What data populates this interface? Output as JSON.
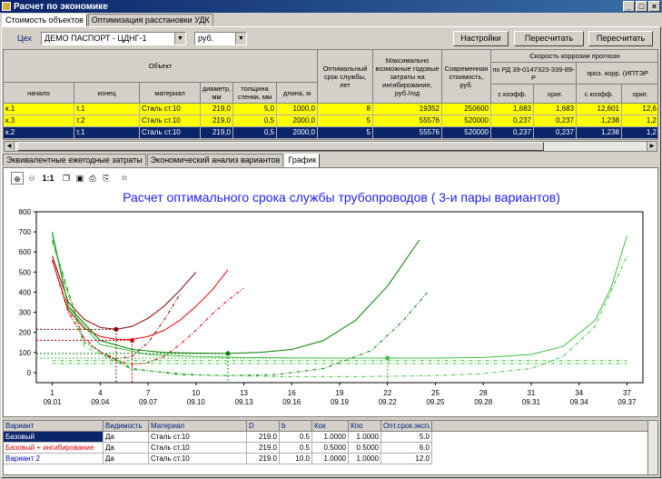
{
  "window": {
    "title": "Расчет по экономике",
    "min": "_",
    "max": "□",
    "close": "×"
  },
  "main_tabs": [
    "Стоимость объектов",
    "Оптимизация расстановки УДК"
  ],
  "toolbar": {
    "shop_label": "Цех",
    "shop_value": "ДЕМО ПАСПОРТ - ЦДНГ-1",
    "currency_value": "руб.",
    "settings": "Настройки",
    "recalc_one": "Пересчитать один",
    "recalc_all": "Пересчитать все"
  },
  "table": {
    "group_object": "Объект",
    "h_start": "начало",
    "h_end": "конец",
    "h_material": "материал",
    "h_diam": "диаметр, мм",
    "h_thick": "толщина стенки, мм",
    "h_len": "длина, м",
    "h_opt": "Оптимальный срок службы, лет",
    "h_max": "Максимально возможные годовые затраты на ингибирование, руб./год",
    "h_cost": "Современная стоимость, руб.",
    "group_corr": "Скорость коррозии прогнозн",
    "h_rd": "по РД 39-0147323-339-89-Р",
    "h_eroz": "эроз. корр. (ИПТЭР",
    "h_kcoef": "с коэфф.",
    "h_orig": "ориг.",
    "h_kcoef2": "с коэфф.",
    "h_orig2": "ориг.",
    "rows": [
      {
        "start": "к.1",
        "end": "т.1",
        "mat": "Сталь ст.10",
        "d": "219,0",
        "t": "5,0",
        "len": "1000,0",
        "opt": "8",
        "max": "19352",
        "cost": "250600",
        "k1": "1,683",
        "o1": "1,683",
        "k2": "12,601",
        "o2": "12,6"
      },
      {
        "start": "к.3",
        "end": "т.2",
        "mat": "Сталь ст.10",
        "d": "219,0",
        "t": "0,5",
        "len": "2000,0",
        "opt": "5",
        "max": "55576",
        "cost": "520000",
        "k1": "0,237",
        "o1": "0,237",
        "k2": "1,238",
        "o2": "1,2"
      },
      {
        "start": "к.2",
        "end": "т.1",
        "mat": "Сталь ст.10",
        "d": "219,0",
        "t": "0,5",
        "len": "2000,0",
        "opt": "5",
        "max": "55576",
        "cost": "520000",
        "k1": "0,237",
        "o1": "0,237",
        "k2": "1,238",
        "o2": "1,2"
      }
    ]
  },
  "sub_tabs": [
    "Эквивалентные ежегодные затраты",
    "Экономический анализ вариантов",
    "График"
  ],
  "chart_toolbar": [
    "zoom-in-icon",
    "zoom-out-icon",
    "actual-size-icon",
    "copy-icon",
    "save-icon",
    "print-icon",
    "print-preview-icon",
    "settings-icon"
  ],
  "chart_toolbar_text": {
    "one_to_one": "1:1"
  },
  "chart_data": {
    "type": "line",
    "title": "Расчет оптимального срока службы трубопроводов  ( 3-и пары вариантов)",
    "ylim": [
      -50,
      800
    ],
    "yticks": [
      0,
      100,
      200,
      300,
      400,
      500,
      600,
      700,
      800
    ],
    "xticks": [
      {
        "v": 1,
        "d": "09.01"
      },
      {
        "v": 4,
        "d": "09.04"
      },
      {
        "v": 7,
        "d": "09.07"
      },
      {
        "v": 10,
        "d": "09.10"
      },
      {
        "v": 13,
        "d": "09.13"
      },
      {
        "v": 16,
        "d": "09.16"
      },
      {
        "v": 19,
        "d": "09.19"
      },
      {
        "v": 22,
        "d": "09.22"
      },
      {
        "v": 25,
        "d": "09.25"
      },
      {
        "v": 28,
        "d": "09.28"
      },
      {
        "v": 31,
        "d": "09.31"
      },
      {
        "v": 34,
        "d": "09.34"
      },
      {
        "v": 37,
        "d": "09.37"
      }
    ],
    "xlim": [
      0,
      38
    ],
    "series": [
      {
        "color": "#800000",
        "dash": false,
        "x": [
          1,
          2,
          3,
          4,
          5,
          6,
          7,
          8,
          9,
          10
        ],
        "y": [
          580,
          350,
          265,
          225,
          215,
          230,
          270,
          330,
          410,
          500
        ]
      },
      {
        "color": "#800000",
        "dash": true,
        "x": [
          1,
          2,
          3,
          4,
          5,
          6,
          7,
          8,
          9
        ],
        "y": [
          560,
          300,
          170,
          100,
          70,
          80,
          150,
          260,
          390
        ]
      },
      {
        "color": "#e00000",
        "dash": false,
        "x": [
          1,
          2,
          3,
          4,
          5,
          6,
          7,
          8,
          9,
          10,
          11,
          12
        ],
        "y": [
          560,
          310,
          220,
          180,
          165,
          165,
          180,
          210,
          260,
          330,
          410,
          510
        ]
      },
      {
        "color": "#e00000",
        "dash": true,
        "x": [
          1,
          2,
          3,
          4,
          5,
          6,
          7,
          8,
          9,
          10,
          11,
          12,
          13
        ],
        "y": [
          560,
          300,
          170,
          100,
          60,
          40,
          50,
          80,
          140,
          210,
          290,
          360,
          420
        ]
      },
      {
        "color": "#008000",
        "dash": false,
        "x": [
          1,
          2,
          4,
          6,
          8,
          10,
          12,
          14,
          16,
          18,
          20,
          22,
          24
        ],
        "y": [
          700,
          330,
          160,
          115,
          100,
          97,
          95,
          100,
          115,
          160,
          260,
          430,
          660
        ]
      },
      {
        "color": "#008000",
        "dash": true,
        "x": [
          1,
          3,
          6,
          9,
          12,
          15,
          18,
          21,
          23,
          24.5
        ],
        "y": [
          660,
          150,
          20,
          -10,
          -15,
          -10,
          20,
          110,
          260,
          400
        ]
      },
      {
        "color": "#40c040",
        "dash": false,
        "x": [
          1,
          2,
          4,
          7,
          10,
          13,
          16,
          19,
          22,
          25,
          28,
          31,
          33,
          35,
          36,
          37
        ],
        "y": [
          690,
          320,
          140,
          90,
          80,
          75,
          73,
          72,
          72,
          72,
          75,
          90,
          130,
          260,
          420,
          680
        ]
      },
      {
        "color": "#40c040",
        "dash": true,
        "x": [
          1,
          3,
          6,
          10,
          15,
          20,
          25,
          28,
          31,
          33,
          35,
          37
        ],
        "y": [
          650,
          130,
          15,
          -10,
          -20,
          -20,
          -15,
          -5,
          20,
          80,
          230,
          580
        ]
      },
      {
        "color": "#40c040",
        "dash": true,
        "x": [
          1,
          37
        ],
        "y": [
          45,
          45
        ]
      },
      {
        "color": "#40c040",
        "dash": true,
        "x": [
          1,
          37
        ],
        "y": [
          60,
          60
        ]
      }
    ],
    "optima": [
      {
        "color": "#800000",
        "x": 5,
        "y": 215
      },
      {
        "color": "#e00000",
        "x": 6,
        "y": 160
      },
      {
        "color": "#008000",
        "x": 12,
        "y": 95
      },
      {
        "color": "#40c040",
        "x": 22,
        "y": 72
      }
    ]
  },
  "bottom": {
    "headers": [
      "Вариант",
      "Видимость",
      "Материал",
      "D",
      "b",
      "Кок",
      "Кпо",
      "Опт.срок.эксп."
    ],
    "rows": [
      {
        "name": "Базовый",
        "vis": "Да",
        "mat": "Сталь ст.10",
        "d": "219.0",
        "b": "0.5",
        "kok": "1.0000",
        "kpo": "1.0000",
        "opt": "5.0",
        "color": "#ffffff",
        "bg": "#0a246a"
      },
      {
        "name": "Базовый + ингибирование",
        "vis": "Да",
        "mat": "Сталь ст.10",
        "d": "219.0",
        "b": "0.5",
        "kok": "0.5000",
        "kpo": "0.5000",
        "opt": "6.0",
        "color": "#e00000",
        "bg": "#ffffff"
      },
      {
        "name": "Вариант 2",
        "vis": "Да",
        "mat": "Сталь ст.10",
        "d": "219.0",
        "b": "10.0",
        "kok": "1.0000",
        "kpo": "1.0000",
        "opt": "12.0",
        "color": "#0000c0",
        "bg": "#ffffff"
      }
    ]
  }
}
